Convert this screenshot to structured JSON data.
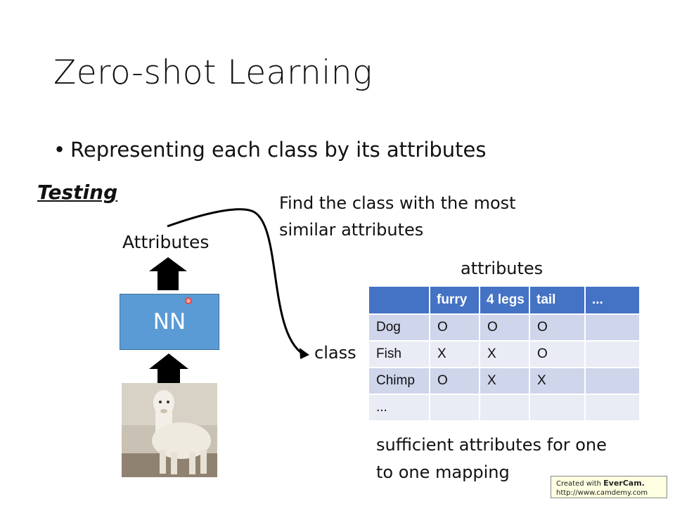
{
  "title": "Zero-shot Learning",
  "bullet": "Representing each class by its attributes",
  "section": "Testing",
  "diagram": {
    "attributes_label": "Attributes",
    "nn_label": "NN",
    "find_line1": "Find the class with the most",
    "find_line2": "similar attributes",
    "class_label": "class",
    "photo_subject": "alpaca photo"
  },
  "table": {
    "caption": "attributes",
    "headers": [
      "",
      "furry",
      "4 legs",
      "tail",
      "..."
    ],
    "rows": [
      [
        "Dog",
        "O",
        "O",
        "O",
        ""
      ],
      [
        "Fish",
        "X",
        "X",
        "O",
        ""
      ],
      [
        "Chimp",
        "O",
        "X",
        "X",
        ""
      ],
      [
        "...",
        "",
        "",
        "",
        ""
      ]
    ]
  },
  "note_line1": "sufficient attributes for one",
  "note_line2": "to one mapping",
  "watermark": {
    "line1_prefix": "Created with ",
    "line1_brand": "EverCam.",
    "line2": "http://www.camdemy.com"
  },
  "colors": {
    "nn_box": "#5b9bd5",
    "table_header": "#4472c4",
    "row_dark": "#cfd5ea",
    "row_light": "#e9ebf5"
  }
}
